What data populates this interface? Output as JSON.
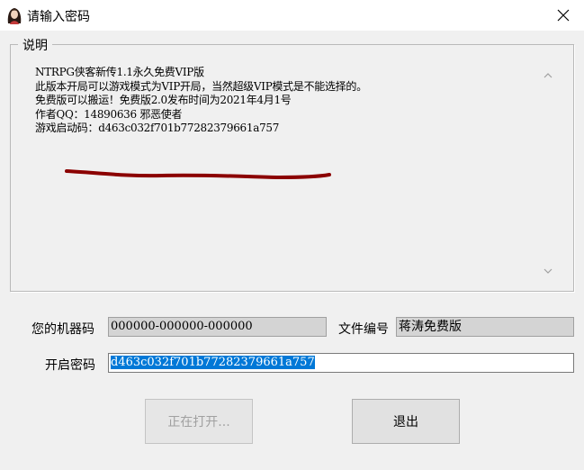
{
  "window": {
    "title": "请输入密码"
  },
  "notes": {
    "group_label": "说明",
    "lines": [
      "NTRPG侠客新传1.1永久免费VIP版",
      "此版本开局可以游戏模式为VIP开局，当然超级VIP模式是不能选择的。",
      "免费版可以搬运！免费版2.0发布时间为2021年4月1号",
      "作者QQ：14890636 邪恶使者",
      "游戏启动码：d463c032f701b77282379661a757"
    ]
  },
  "machine": {
    "label": "您的机器码",
    "value": "000000-000000-000000"
  },
  "file": {
    "label": "文件编号",
    "value": "蒋涛免费版"
  },
  "password": {
    "label": "开启密码",
    "value": "d463c032f701b77282379661a757"
  },
  "buttons": {
    "open_label": "正在打开...",
    "exit_label": "退出"
  },
  "colors": {
    "underline_mark": "#8b0000",
    "selection": "#0078d7",
    "client_bg": "#f0f0f0"
  }
}
